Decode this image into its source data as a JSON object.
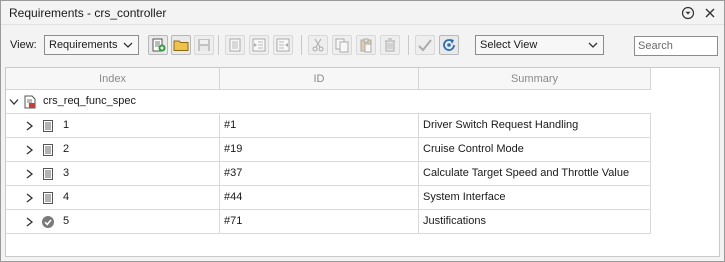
{
  "window": {
    "title": "Requirements - crs_controller"
  },
  "toolbar": {
    "view_label": "View:",
    "view_select_value": "Requirements",
    "view_mode_select_value": "Select View",
    "search_placeholder": "Search"
  },
  "columns": {
    "index": "Index",
    "id": "ID",
    "summary": "Summary"
  },
  "parent": {
    "name": "crs_req_func_spec"
  },
  "rows": [
    {
      "index": "1",
      "id": "#1",
      "summary": "Driver Switch Request Handling",
      "icon": "requirement-doc-icon"
    },
    {
      "index": "2",
      "id": "#19",
      "summary": "Cruise Control Mode",
      "icon": "requirement-doc-icon"
    },
    {
      "index": "3",
      "id": "#37",
      "summary": "Calculate Target Speed and Throttle Value",
      "icon": "requirement-doc-icon"
    },
    {
      "index": "4",
      "id": "#44",
      "summary": "System Interface",
      "icon": "requirement-doc-icon"
    },
    {
      "index": "5",
      "id": "#71",
      "summary": "Justifications",
      "icon": "justification-check-icon"
    }
  ]
}
